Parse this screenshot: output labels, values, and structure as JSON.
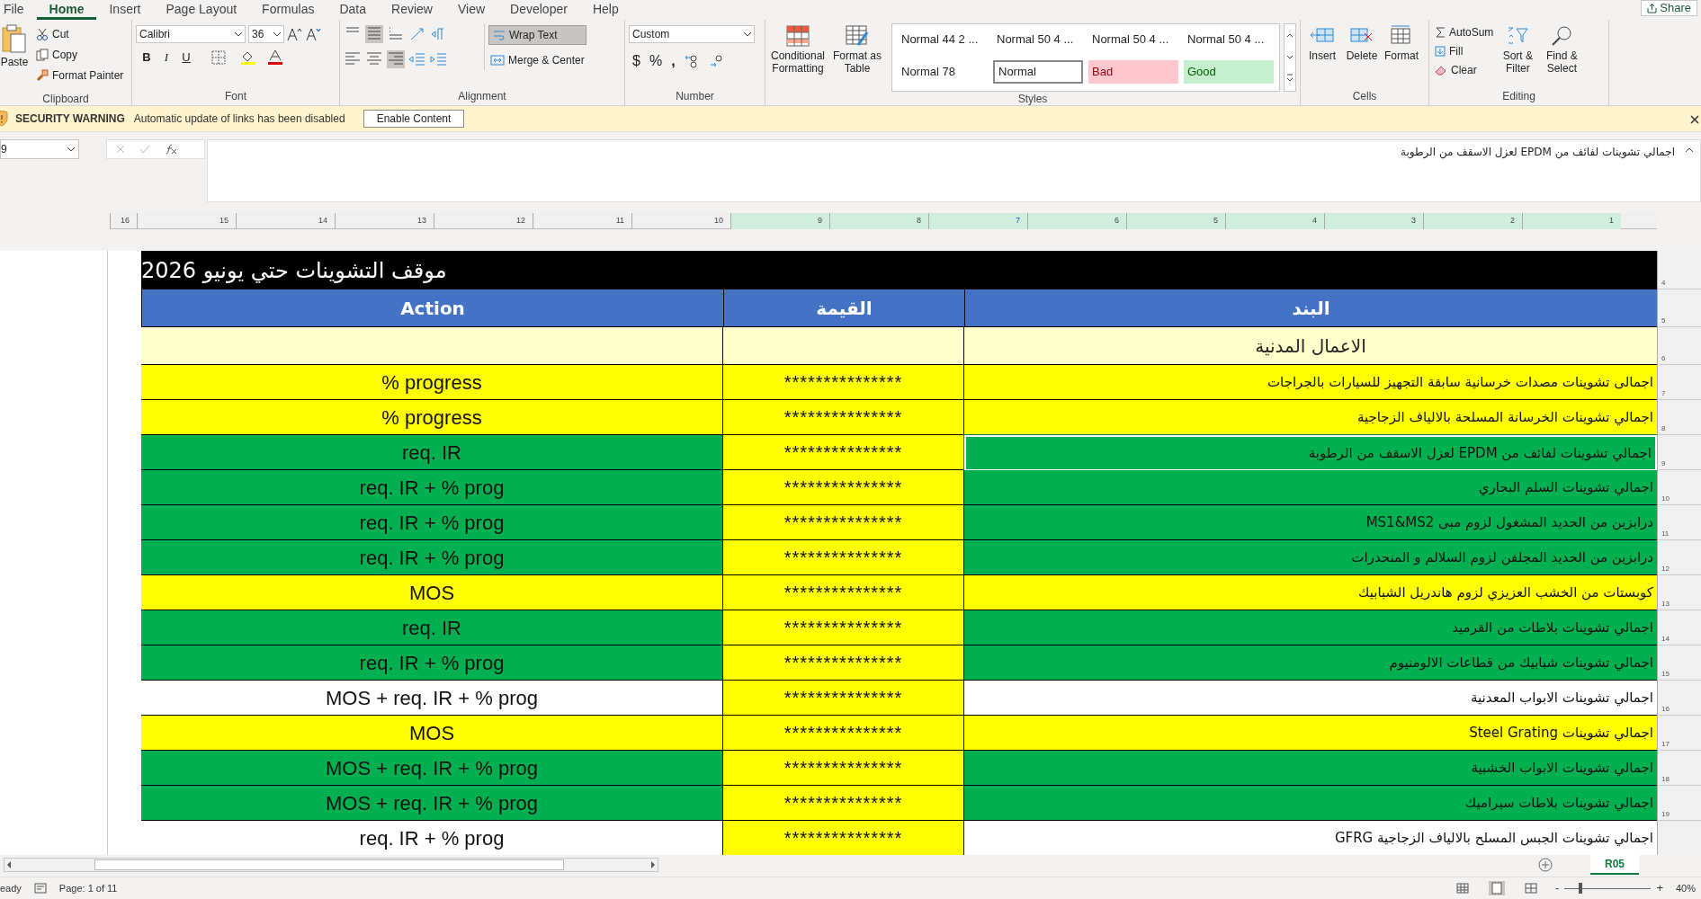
{
  "ribbon_tabs": [
    {
      "label": "File",
      "selected": false
    },
    {
      "label": "Home",
      "selected": true
    },
    {
      "label": "Insert",
      "selected": false
    },
    {
      "label": "Page Layout",
      "selected": false
    },
    {
      "label": "Formulas",
      "selected": false
    },
    {
      "label": "Data",
      "selected": false
    },
    {
      "label": "Review",
      "selected": false
    },
    {
      "label": "View",
      "selected": false
    },
    {
      "label": "Developer",
      "selected": false
    },
    {
      "label": "Help",
      "selected": false
    }
  ],
  "share_button": "Share",
  "clipboard": {
    "paste": "Paste",
    "cut": "Cut",
    "copy": "Copy",
    "format_painter": "Format Painter",
    "group_label": "Clipboard"
  },
  "font": {
    "name": "Calibri",
    "size": "36",
    "bold": "B",
    "italic": "I",
    "underline": "U",
    "group_label": "Font"
  },
  "alignment": {
    "wrap_text": "Wrap Text",
    "merge_center": "Merge & Center",
    "group_label": "Alignment"
  },
  "number": {
    "format": "Custom",
    "currency": "$",
    "percent": "%",
    "comma": ",",
    "group_label": "Number"
  },
  "styles": {
    "conditional": "Conditional Formatting",
    "format_table": "Format as Table",
    "group_label": "Styles",
    "gallery": [
      {
        "label": "Normal 44 2 ...",
        "kind": "plain"
      },
      {
        "label": "Normal 50 4 ...",
        "kind": "plain"
      },
      {
        "label": "Normal 50 4 ...",
        "kind": "plain"
      },
      {
        "label": "Normal 50 4 ...",
        "kind": "plain"
      },
      {
        "label": "Normal 78",
        "kind": "plain"
      },
      {
        "label": "Normal",
        "kind": "current"
      },
      {
        "label": "Bad",
        "kind": "bad"
      },
      {
        "label": "Good",
        "kind": "good"
      }
    ]
  },
  "cells": {
    "buttons": [
      "Insert",
      "Delete",
      "Format"
    ],
    "group_label": "Cells"
  },
  "editing": {
    "autosum": "AutoSum",
    "fill": "Fill",
    "clear": "Clear",
    "sort": "Sort & Filter",
    "find": "Find & Select",
    "group_label": "Editing"
  },
  "security_bar": {
    "title": "SECURITY WARNING",
    "message": "Automatic update of links has been disabled",
    "button": "Enable Content"
  },
  "formula_bar": {
    "name_box": "9",
    "formula": "اجمالي تشوينات لفائف من EPDM لعزل الاسقف من الرطوبة"
  },
  "ruler": [
    "16",
    "15",
    "14",
    "13",
    "12",
    "11",
    "10",
    "9",
    "8",
    "7",
    "6",
    "5",
    "4",
    "3",
    "2",
    "1"
  ],
  "sheet": {
    "title": "موقف التشوينات حتي يونيو 2026",
    "columns": [
      "البند",
      "القيمة",
      "Action"
    ],
    "section": "الاعمال المدنية",
    "rows": [
      {
        "item": "اجمالى تشوينات مصدات خرسانية سابقة التجهيز للسيارات بالجراجات",
        "value": "***************",
        "action": "% progress",
        "color": "#ffff00",
        "selected": false
      },
      {
        "item": "اجمالي تشوينات الخرسانة المسلحة بالالياف الزجاجية",
        "value": "***************",
        "action": "% progress",
        "color": "#ffff00",
        "selected": false
      },
      {
        "item": "اجمالي تشوينات لفائف من EPDM لعزل الاسقف من الرطوبة",
        "value": "***************",
        "action": "req. IR",
        "color": "#00b050",
        "selected": true
      },
      {
        "item": "اجمالي تشوينات السلم البحاري",
        "value": "***************",
        "action": "req. IR + % prog",
        "color": "#00b050",
        "selected": false
      },
      {
        "item": "درابزين من الحديد المشغول لزوم مبى MS1&MS2",
        "value": "***************",
        "action": "req. IR + % prog",
        "color": "#00b050",
        "selected": false
      },
      {
        "item": "درابزين من الحديد المجلفن لزوم السلالم و المنحدرات",
        "value": "***************",
        "action": "req. IR + % prog",
        "color": "#00b050",
        "selected": false
      },
      {
        "item": "كوبستات من الخشب العزيزي لزوم هاندريل الشبابيك",
        "value": "***************",
        "action": "MOS",
        "color": "#ffff00",
        "selected": false
      },
      {
        "item": "اجمالي تشوينات بلاطات من القرميد",
        "value": "***************",
        "action": "req. IR",
        "color": "#00b050",
        "selected": false
      },
      {
        "item": "اجمالي تشوينات شبابيك من قطاعات الالومنيوم",
        "value": "***************",
        "action": "req. IR + % prog",
        "color": "#00b050",
        "selected": false
      },
      {
        "item": "اجمالي تشوينات الابواب المعدنية",
        "value": "***************",
        "action": "MOS + req. IR + % prog",
        "color": "#ffffff",
        "selected": false
      },
      {
        "item": "اجمالي تشوينات Steel Grating",
        "value": "***************",
        "action": "MOS",
        "color": "#ffff00",
        "selected": false
      },
      {
        "item": "اجمالي تشوينات الابواب الخشبية",
        "value": "***************",
        "action": "MOS + req. IR + % prog",
        "color": "#00b050",
        "selected": false
      },
      {
        "item": "اجمالي تشوينات بلاطات سيراميك",
        "value": "***************",
        "action": "MOS + req. IR + % prog",
        "color": "#00b050",
        "selected": false
      },
      {
        "item": "اجمالي تشوينات الجبس المسلح بالالياف الزجاجية GFRG",
        "value": "***************",
        "action": "req. IR + % prog",
        "color": "#ffffff",
        "selected": false
      }
    ]
  },
  "row_numbers": [
    "4",
    "5",
    "6",
    "7",
    "8",
    "9",
    "10",
    "11",
    "12",
    "13",
    "14",
    "15",
    "16",
    "17",
    "18",
    "19"
  ],
  "sheet_tabs": [
    {
      "label": "R05",
      "selected": true
    }
  ],
  "status_bar": {
    "mode": "eady",
    "page": "Page: 1 of 11",
    "zoom_out": "-",
    "zoom_in": "+",
    "zoom": "40%",
    "level": 0.17
  }
}
